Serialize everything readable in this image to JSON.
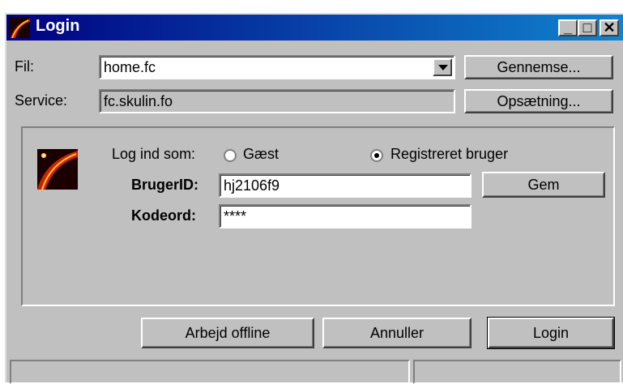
{
  "window": {
    "title": "Login"
  },
  "title_buttons": {
    "minimize_icon": "minimize-icon",
    "maximize_icon": "maximize-icon",
    "close_icon": "close-icon"
  },
  "file": {
    "label": "Fil:",
    "value": "home.fc"
  },
  "service": {
    "label": "Service:",
    "value": "fc.skulin.fo"
  },
  "buttons": {
    "browse": "Gennemse...",
    "setup": "Opsætning...",
    "save": "Gem",
    "offline": "Arbejd offline",
    "cancel": "Annuller",
    "login": "Login"
  },
  "login_as": {
    "label": "Log ind som:",
    "options": [
      {
        "label": "Gæst",
        "selected": false
      },
      {
        "label": "Registreret bruger",
        "selected": true
      }
    ]
  },
  "user": {
    "label": "BrugerID:",
    "value": "hj2106f9"
  },
  "password": {
    "label": "Kodeord:",
    "value": "****"
  },
  "colors": {
    "titlebar": "#000080",
    "face": "#c0c0c0"
  }
}
